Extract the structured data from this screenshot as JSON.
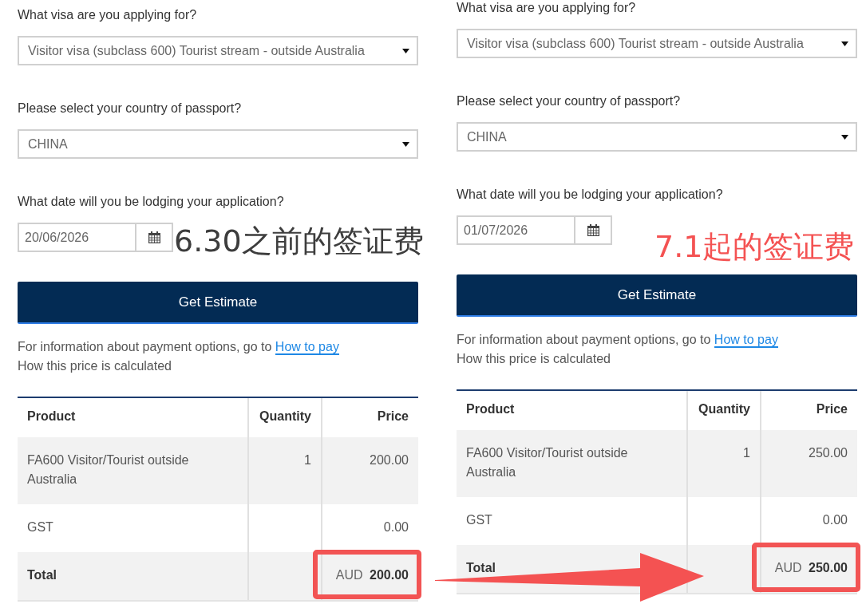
{
  "panels": [
    {
      "fields": [
        {
          "kind": "select",
          "label": "What visa are you applying for?",
          "value": "Visitor visa (subclass 600) Tourist stream - outside Australia"
        },
        {
          "kind": "select",
          "label": "Please select your country of passport?",
          "value": "CHINA"
        },
        {
          "kind": "date",
          "label": "What date will you be lodging your application?",
          "value": "20/06/2026"
        }
      ],
      "annotation": {
        "text": "6.30之前的签证费",
        "color": "#3d3d3d"
      },
      "button": "Get Estimate",
      "payment_note": {
        "text": "For information about payment options, go to",
        "link": "How to pay"
      },
      "price_note": "How this price is calculated",
      "table": {
        "columns": [
          "Product",
          "Quantity",
          "Price"
        ],
        "rows": [
          {
            "kind": "item",
            "product": "FA600 Visitor/Tourist outside Australia",
            "quantity": "1",
            "price": "200.00"
          },
          {
            "kind": "item",
            "product": "GST",
            "price": "0.00"
          },
          {
            "kind": "total",
            "product": "Total",
            "currency": "AUD",
            "price": "200.00",
            "highlighted": true
          }
        ]
      }
    },
    {
      "fields": [
        {
          "kind": "select",
          "label": "What visa are you applying for?",
          "value": "Visitor visa (subclass 600) Tourist stream - outside Australia"
        },
        {
          "kind": "select",
          "label": "Please select your country of passport?",
          "value": "CHINA"
        },
        {
          "kind": "date",
          "label": "What date will you be lodging your application?",
          "value": "01/07/2026"
        }
      ],
      "annotation": {
        "text": "7.1起的签证费",
        "color": "#f45252"
      },
      "button": "Get Estimate",
      "payment_note": {
        "text": "For information about payment options, go to",
        "link": "How to pay"
      },
      "price_note": "How this price is calculated",
      "table": {
        "columns": [
          "Product",
          "Quantity",
          "Price"
        ],
        "rows": [
          {
            "kind": "item",
            "product": "FA600 Visitor/Tourist outside Australia",
            "quantity": "1",
            "price": "250.00"
          },
          {
            "kind": "item",
            "product": "GST",
            "price": "0.00"
          },
          {
            "kind": "total",
            "product": "Total",
            "currency": "AUD",
            "price": "250.00",
            "highlighted": true
          }
        ]
      }
    }
  ]
}
